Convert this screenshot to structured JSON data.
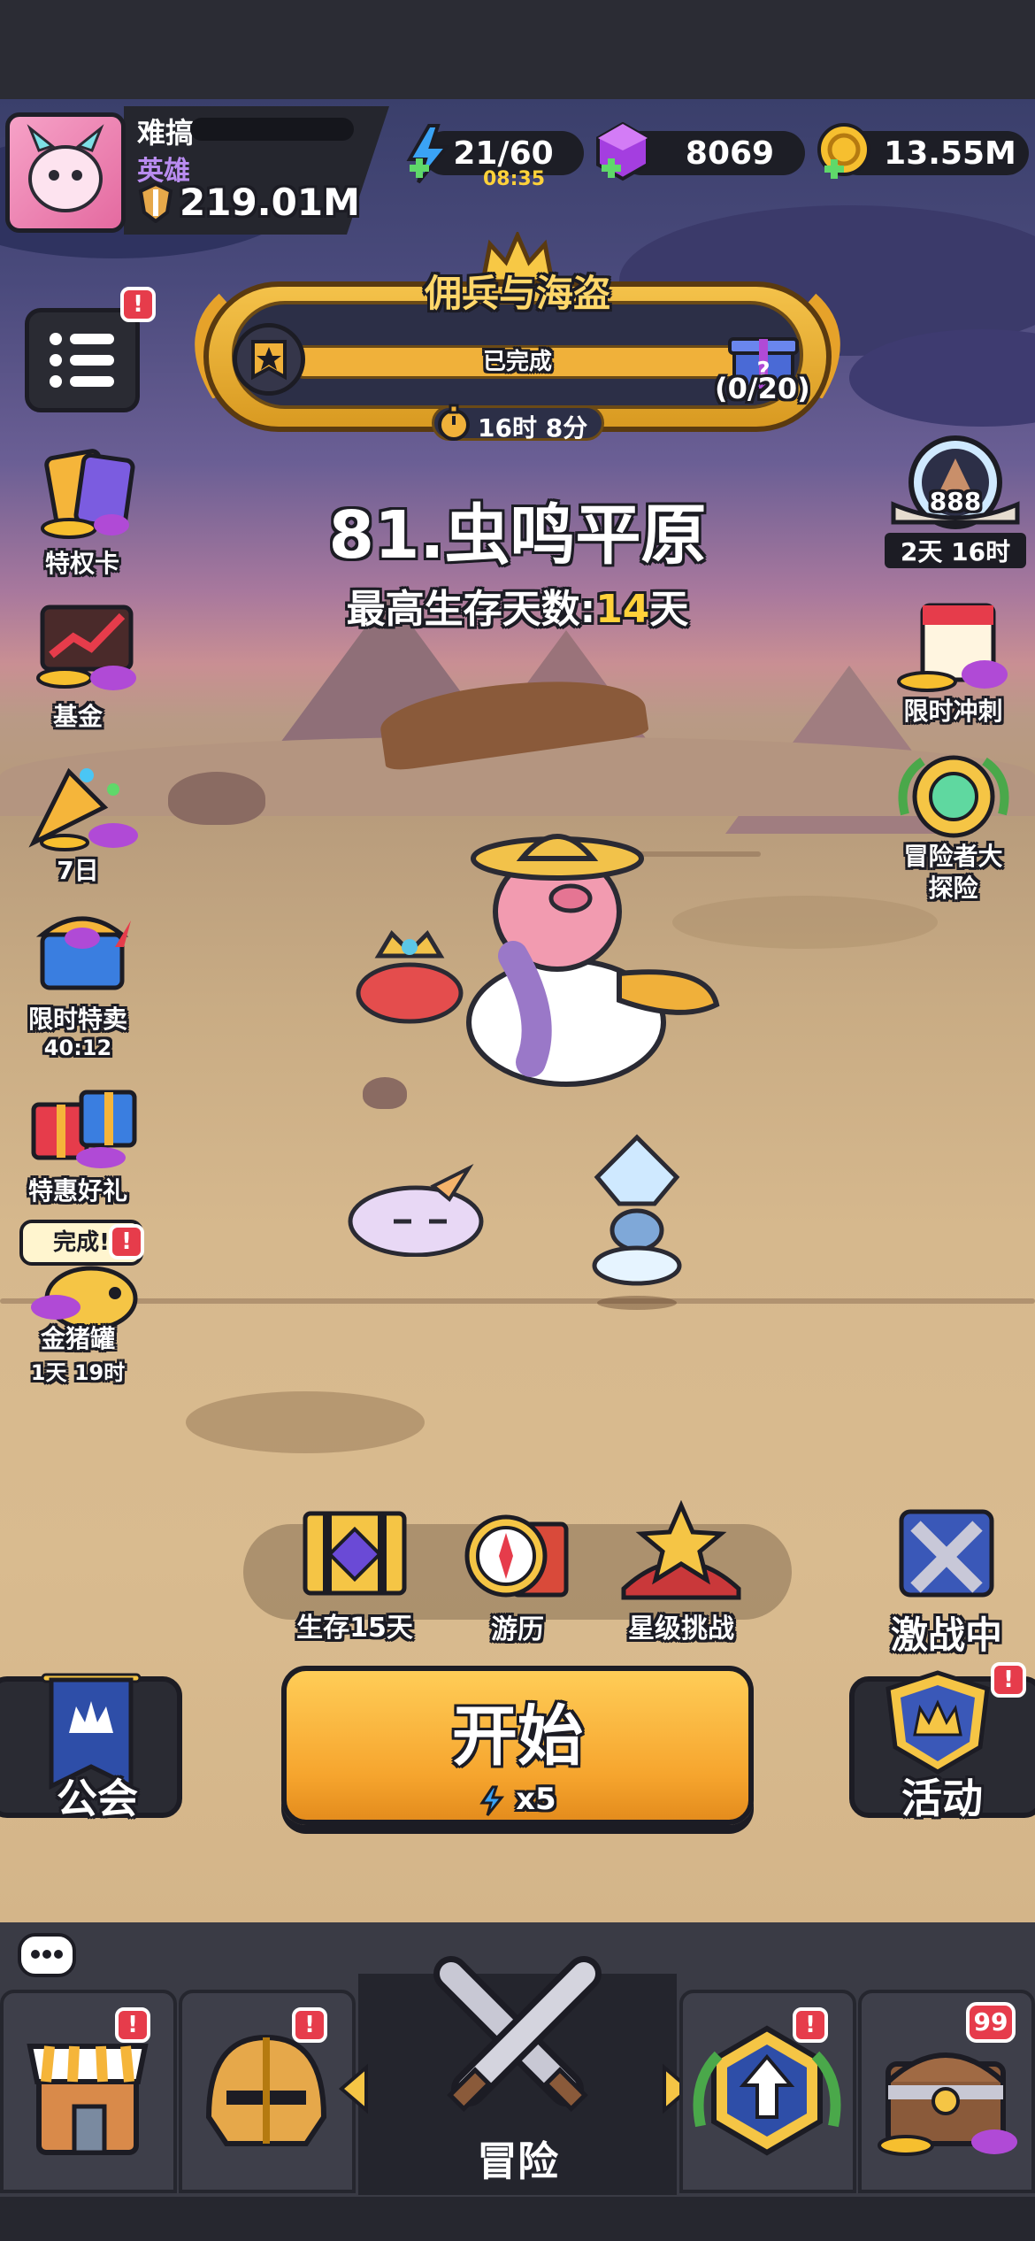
{
  "player": {
    "name": "难搞",
    "title": "英雄",
    "power": "219.01M"
  },
  "resources": {
    "energy": "21/60",
    "energy_timer": "08:35",
    "gems": "8069",
    "gold": "13.55M"
  },
  "event_banner": {
    "title": "佣兵与海盗",
    "status": "已完成",
    "progress": "(0/20)",
    "timer": "16时 8分"
  },
  "stage": {
    "name": "81.虫鸣平原",
    "best_label": "最高生存天数:",
    "best_value": "14",
    "best_unit": "天"
  },
  "left_menu": {
    "items": [
      {
        "label": "特权卡"
      },
      {
        "label": "基金"
      },
      {
        "label": "7日"
      },
      {
        "label": "限时特卖",
        "sub": "40:12"
      },
      {
        "label": "特惠好礼"
      },
      {
        "label": "金猪罐",
        "sub": "1天 19时",
        "bubble": "完成!"
      }
    ]
  },
  "right_menu": {
    "arena": {
      "count": "888",
      "timer": "2天 16时"
    },
    "items": [
      {
        "label": "限时冲刺"
      },
      {
        "label": "冒险者大\n探险"
      }
    ]
  },
  "actions": {
    "survive": "生存15天",
    "travel": "游历",
    "star": "星级挑战",
    "battle": "激战中"
  },
  "start": {
    "label": "开始",
    "cost": "x5"
  },
  "guild": {
    "label": "公会"
  },
  "activity": {
    "label": "活动"
  },
  "nav": {
    "center_label": "冒险",
    "chest_count": "99"
  },
  "badges": {
    "alert": "!"
  },
  "colors": {
    "accent_gold": "#f6a52e",
    "highlight_yellow": "#ffd23a",
    "badge_red": "#e63c4b",
    "dark": "#1c1c24"
  }
}
